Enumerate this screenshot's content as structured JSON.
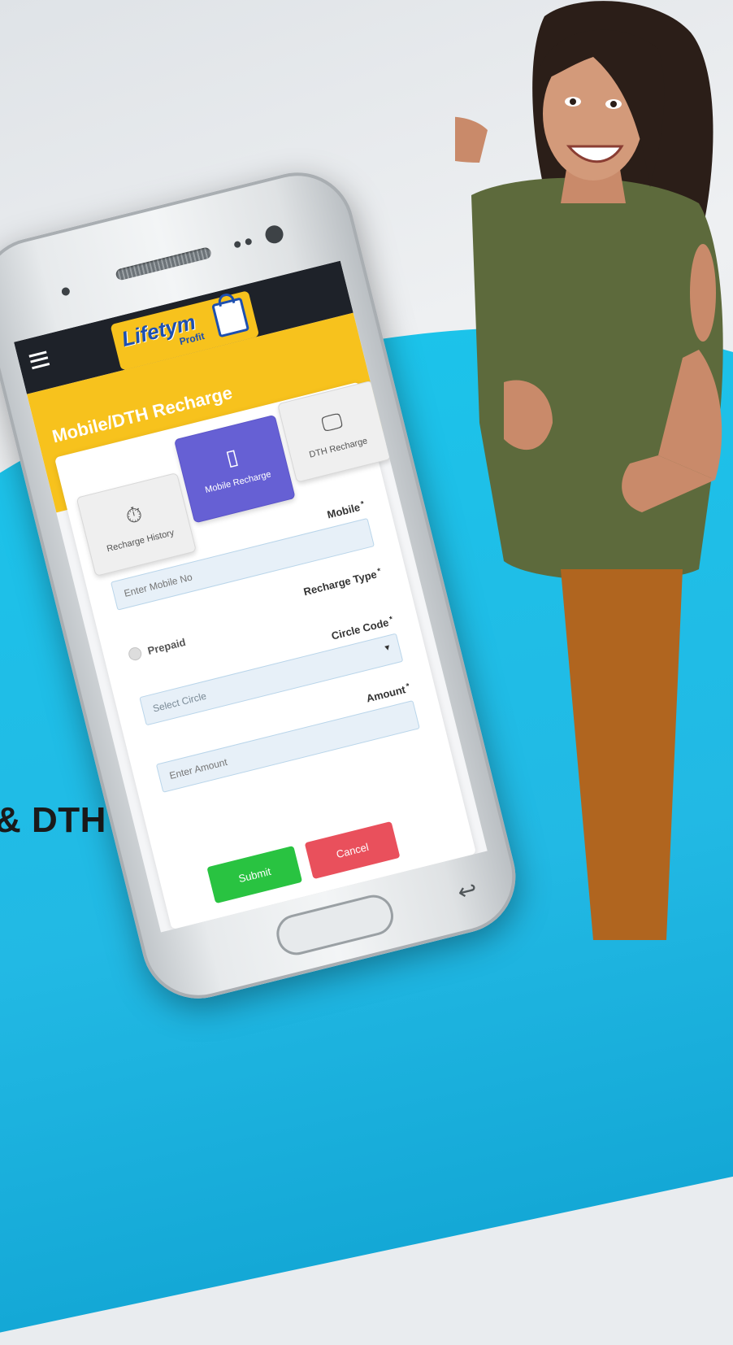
{
  "banner": {
    "headline": "& DTH"
  },
  "app": {
    "logo_text": "Lifetym",
    "logo_sub": "Profit",
    "page_title": "Mobile/DTH Recharge",
    "tabs": [
      {
        "label": "Recharge History",
        "icon": "stopwatch-icon"
      },
      {
        "label": "Mobile Recharge",
        "icon": "smartphone-icon"
      },
      {
        "label": "DTH Recharge",
        "icon": "monitor-icon"
      }
    ],
    "active_tab": "Mobile Recharge",
    "form": {
      "mobile_label": "Mobile",
      "mobile_placeholder": "Enter Mobile No",
      "recharge_type_label": "Recharge Type",
      "recharge_type_option": "Prepaid",
      "circle_label": "Circle Code",
      "circle_value": "Select Circle",
      "amount_label": "Amount",
      "amount_placeholder": "Enter Amount",
      "required_mark": "*"
    },
    "buttons": {
      "submit": "Submit",
      "cancel": "Cancel"
    }
  },
  "colors": {
    "accent": "#6660d4",
    "header": "#1e2229",
    "band": "#f7c21d",
    "submit": "#29c341",
    "cancel": "#e9505c",
    "background_blue": "#1cc3ea"
  }
}
